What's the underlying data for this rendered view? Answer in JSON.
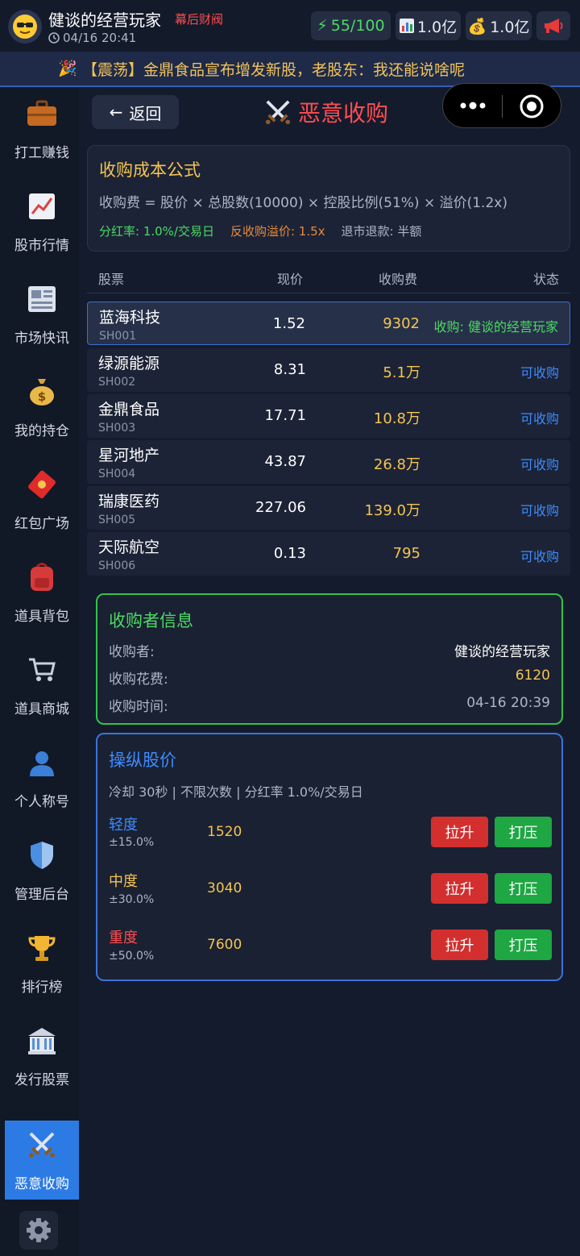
{
  "user": {
    "name": "健谈的经营玩家",
    "tag": "幕后财阀",
    "time": "04/16 20:41"
  },
  "stats": {
    "energy": "55/100",
    "assets": "1.0亿",
    "cash": "1.0亿"
  },
  "ticker": "【震荡】金鼎食品宣布增发新股，老股东：我还能说啥呢",
  "sidebar": [
    "打工赚钱",
    "股市行情",
    "市场快讯",
    "我的持仓",
    "红包广场",
    "道具背包",
    "道具商城",
    "个人称号",
    "管理后台",
    "排行榜",
    "发行股票",
    "恶意收购"
  ],
  "header": {
    "back": "返回",
    "title": "恶意收购"
  },
  "formula": {
    "title": "收购成本公式",
    "expr": "收购费 = 股价 × 总股数(10000) × 控股比例(51%) × 溢价(1.2x)",
    "dividend": "分红率: 1.0%/交易日",
    "anti": "反收购溢价: 1.5x",
    "refund": "退市退款: 半额"
  },
  "table": {
    "headers": [
      "股票",
      "现价",
      "收购费",
      "状态"
    ],
    "rows": [
      {
        "name": "蓝海科技",
        "code": "SH001",
        "price": "1.52",
        "fee": "9302",
        "status": "收购: 健谈的经营玩家"
      },
      {
        "name": "绿源能源",
        "code": "SH002",
        "price": "8.31",
        "fee": "5.1万",
        "status": "可收购"
      },
      {
        "name": "金鼎食品",
        "code": "SH003",
        "price": "17.71",
        "fee": "10.8万",
        "status": "可收购"
      },
      {
        "name": "星河地产",
        "code": "SH004",
        "price": "43.87",
        "fee": "26.8万",
        "status": "可收购"
      },
      {
        "name": "瑞康医药",
        "code": "SH005",
        "price": "227.06",
        "fee": "139.0万",
        "status": "可收购"
      },
      {
        "name": "天际航空",
        "code": "SH006",
        "price": "0.13",
        "fee": "795",
        "status": "可收购"
      }
    ]
  },
  "acquirer": {
    "title": "收购者信息",
    "who_label": "收购者:",
    "who": "健谈的经营玩家",
    "cost_label": "收购花费:",
    "cost": "6120",
    "time_label": "收购时间:",
    "time": "04-16 20:39"
  },
  "manipulate": {
    "title": "操纵股价",
    "sub": "冷却 30秒 | 不限次数 | 分红率 1.0%/交易日",
    "up": "拉升",
    "down": "打压",
    "levels": [
      {
        "name": "轻度",
        "pct": "±15.0%",
        "cost": "1520",
        "color": "#3d8bff"
      },
      {
        "name": "中度",
        "pct": "±30.0%",
        "cost": "3040",
        "color": "#f5c451"
      },
      {
        "name": "重度",
        "pct": "±50.0%",
        "cost": "7600",
        "color": "#ff4d4f"
      }
    ]
  }
}
